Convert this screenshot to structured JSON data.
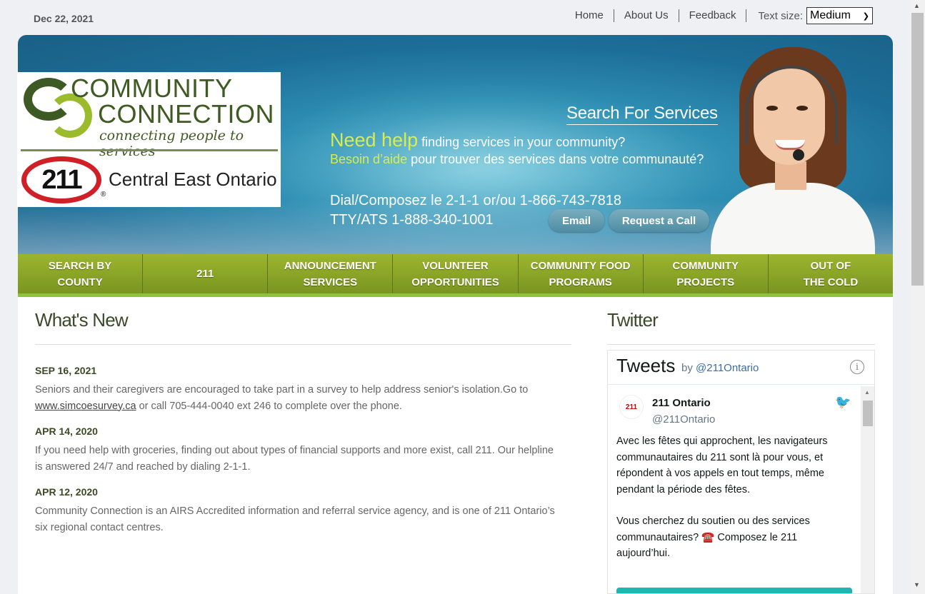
{
  "header": {
    "date": "Dec 22, 2021",
    "nav": [
      "Home",
      "About Us",
      "Feedback"
    ],
    "text_size_label": "Text size:",
    "text_size_value": "Medium"
  },
  "logo": {
    "line1": "COMMUNITY",
    "line2": "CONNECTION",
    "tagline": "connecting people to services",
    "badge": "211",
    "region": "Central East Ontario",
    "reg_mark": "®"
  },
  "banner": {
    "search_title": "Search For Services",
    "need_help": "Need help",
    "need_help_rest": " finding services in your community?",
    "besoin": "Besoin d’aide",
    "besoin_rest": " pour trouver des services dans votre communauté?",
    "dial": "Dial/Composez le 2-1-1 or/ou 1-866-743-7818",
    "tty": "TTY/ATS 1-888-340-1001",
    "email_button": "Email",
    "call_button": "Request a Call"
  },
  "main_nav": [
    {
      "line1": "SEARCH BY",
      "line2": "COUNTY"
    },
    {
      "line1": "211",
      "line2": ""
    },
    {
      "line1": "ANNOUNCEMENT",
      "line2": "SERVICES"
    },
    {
      "line1": "VOLUNTEER",
      "line2": "OPPORTUNITIES"
    },
    {
      "line1": "COMMUNITY FOOD",
      "line2": "PROGRAMS"
    },
    {
      "line1": "COMMUNITY",
      "line2": "PROJECTS"
    },
    {
      "line1": "OUT OF",
      "line2": "THE COLD"
    }
  ],
  "whats_new": {
    "title": "What's New",
    "items": [
      {
        "date": "SEP 16, 2021",
        "text_before": "Seniors and their caregivers are encouraged to take part in a survey to help address senior's isolation.Go to ",
        "link": "www.simcoesurvey.ca",
        "text_after": " or call 705-444-0040 ext 246 to complete over the phone."
      },
      {
        "date": "APR 14, 2020",
        "text_before": "If you need help with groceries, finding out about types of financial supports and more exist, call 211. Our helpline is answered 24/7 and reached by dialing 2-1-1.",
        "link": "",
        "text_after": ""
      },
      {
        "date": "APR 12, 2020",
        "text_before": "Community Connection is an AIRS Accredited information and referral service agency, and is one of 211 Ontario’s six regional contact centres.",
        "link": "",
        "text_after": ""
      }
    ]
  },
  "twitter": {
    "title": "Twitter",
    "widget_title": "Tweets",
    "by": "by ",
    "by_handle": "@211Ontario",
    "tweet": {
      "name": "211 Ontario",
      "handle": "@211Ontario",
      "avatar_text": "211",
      "body_p1": "Avec les fêtes qui approchent, les navigateurs communautaires du 211 sont là pour vous, et répondent à vos appels en tout temps, même pendant la période des fêtes.",
      "body_p2": "Vous cherchez du soutien ou des services communautaires? ☎️ Composez le 211 aujourd’hui."
    }
  },
  "colors": {
    "nav_green": "#8aa626",
    "banner_blue": "#2f8fb4",
    "highlight_yellow": "#d9ec4a",
    "heading_dark": "#3a4a2a"
  }
}
